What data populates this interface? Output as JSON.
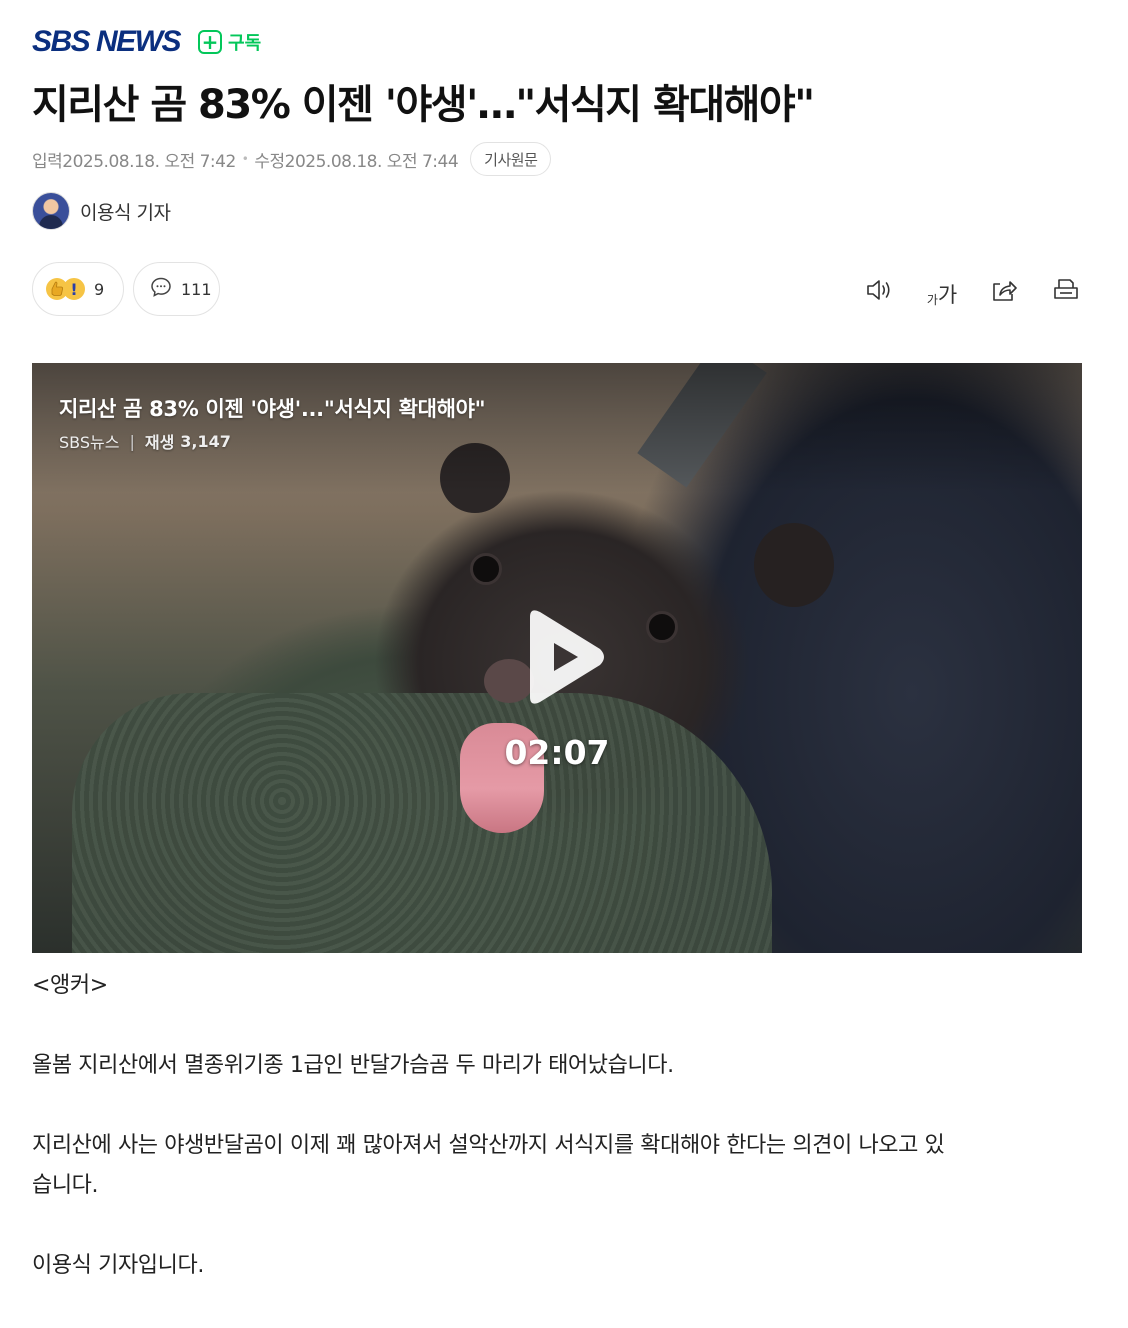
{
  "press": {
    "name": "SBS NEWS",
    "subscribe_label": "구독",
    "subscribe_icon": "plus-icon",
    "brand_color": "#0b2f7f",
    "accent_color": "#03c75a"
  },
  "article": {
    "title": "지리산 곰 83% 이젠 '야생'…\"서식지 확대해야\"",
    "published_label": "입력",
    "published_date": "2025.08.18. 오전 7:42",
    "modified_label": "수정",
    "modified_date": "2025.08.18. 오전 7:44",
    "original_button": "기사원문",
    "reporter": "이용식 기자"
  },
  "reactions": {
    "reaction_count": "9",
    "comment_count": "111",
    "icons": [
      "thumbs-up-icon",
      "exclamation-icon",
      "comment-icon"
    ]
  },
  "tools": {
    "font_small": "가",
    "font_big": "가",
    "icons": [
      "speaker-icon",
      "font-size-icon",
      "share-icon",
      "print-icon"
    ]
  },
  "video": {
    "title": "지리산 곰 83% 이젠 '야생'...\"서식지 확대해야\"",
    "channel": "SBS뉴스",
    "plays_label": "재생",
    "plays": "3,147",
    "duration": "02:07"
  },
  "body": {
    "anchor_tag": "<앵커>",
    "paragraph1": "올봄 지리산에서 멸종위기종 1급인 반달가슴곰 두 마리가 태어났습니다.",
    "paragraph2_line1": "지리산에 사는 야생반달곰이 이제 꽤 많아져서 설악산까지 서식지를 확대해야 한다는 의견이 나오고 있",
    "paragraph2_line2": "습니다.",
    "paragraph3": "이용식 기자입니다."
  }
}
